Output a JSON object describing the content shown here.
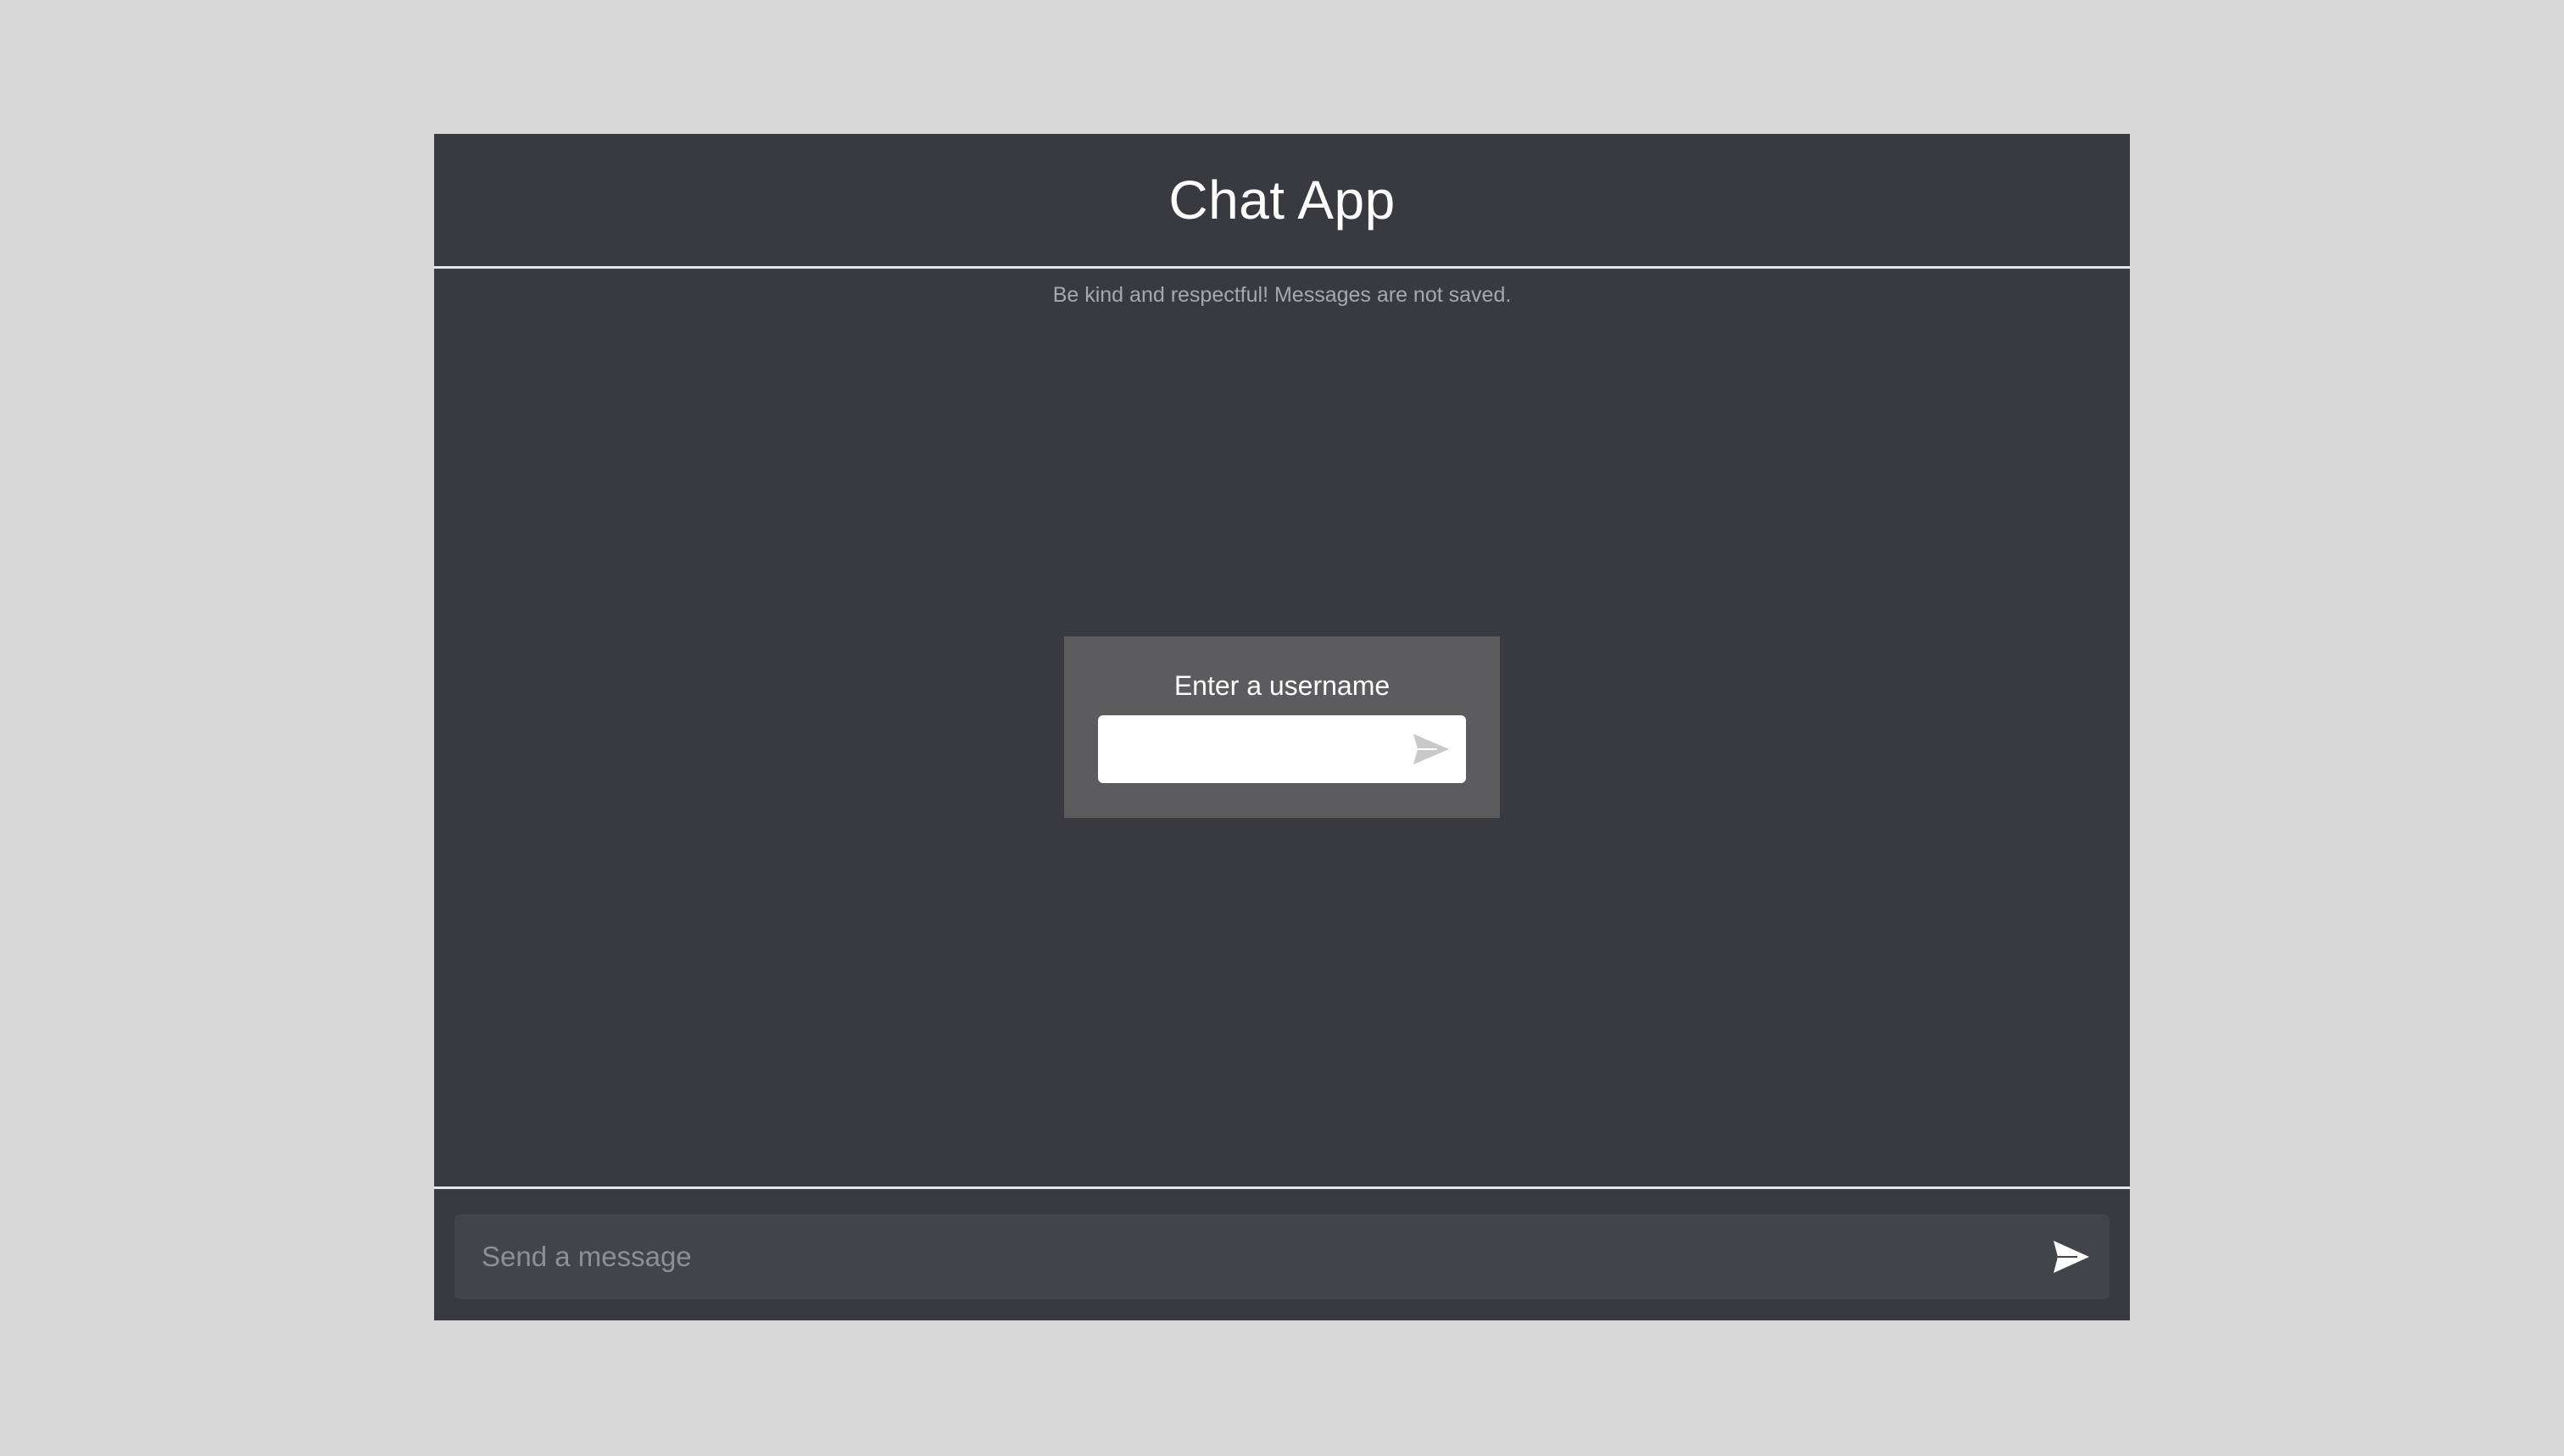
{
  "header": {
    "title": "Chat App"
  },
  "notice": {
    "text": "Be kind and respectful! Messages are not saved."
  },
  "username_modal": {
    "label": "Enter a username",
    "input_value": "",
    "submit_icon": "send-icon"
  },
  "composer": {
    "placeholder": "Send a message",
    "value": "",
    "send_icon": "send-icon"
  },
  "colors": {
    "page_background": "#d8d8d8",
    "app_background": "#393a3f",
    "divider": "#e6e6e6",
    "modal_background": "#5c5c5e",
    "composer_background": "#42444b",
    "username_send_icon": "#c9c9cb",
    "composer_send_icon": "#ffffff"
  }
}
